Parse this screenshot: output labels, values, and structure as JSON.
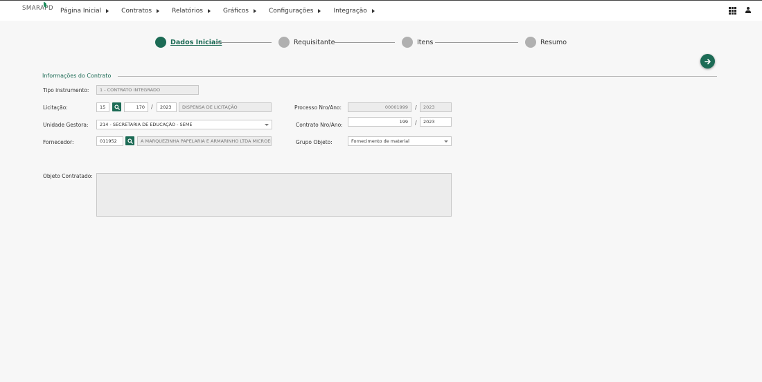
{
  "app": {
    "logo_text": "SMARAPD"
  },
  "nav": {
    "items": [
      {
        "label": "Página Inicial"
      },
      {
        "label": "Contratos"
      },
      {
        "label": "Relatórios"
      },
      {
        "label": "Gráficos"
      },
      {
        "label": "Configurações"
      },
      {
        "label": "Integração"
      }
    ]
  },
  "top_icons": [
    "apps-grid-icon",
    "user-icon"
  ],
  "stepper": {
    "steps": [
      {
        "label": "Dados Iniciais",
        "active": true
      },
      {
        "label": "Requisitante",
        "active": false
      },
      {
        "label": "Itens",
        "active": false
      },
      {
        "label": "Resumo",
        "active": false
      }
    ]
  },
  "section": {
    "title": "Informações do Contrato"
  },
  "form": {
    "tipo_instrumento": {
      "label": "Tipo instrumento:",
      "value": "1 - CONTRATO INTEGRADO"
    },
    "licitacao": {
      "label": "Licitação:",
      "code": "15",
      "numero": "170",
      "ano": "2023",
      "descricao": "DISPENSA DE LICITAÇÃO"
    },
    "unidade_gestora": {
      "label": "Unidade Gestora:",
      "value": "214 - SECRETARIA DE EDUCAÇÃO - SEME"
    },
    "fornecedor": {
      "label": "Fornecedor:",
      "code": "011952",
      "nome": "A MARQUEZINHA PAPELARIA E ARMARINHO LTDA MICROEMP"
    },
    "processo": {
      "label": "Processo Nro/Ano:",
      "numero": "00001999",
      "ano": "2023"
    },
    "contrato": {
      "label": "Contrato Nro/Ano:",
      "numero": "199",
      "ano": "2023"
    },
    "grupo_objeto": {
      "label": "Grupo Objeto:",
      "value": "Fornecimento de material"
    },
    "objeto_contratado": {
      "label": "Objeto Contratado:",
      "value": ""
    },
    "separator": "/"
  },
  "colors": {
    "accent": "#1c6b55",
    "inactive_step": "#b0b0b0",
    "background": "#f7f7f7"
  }
}
